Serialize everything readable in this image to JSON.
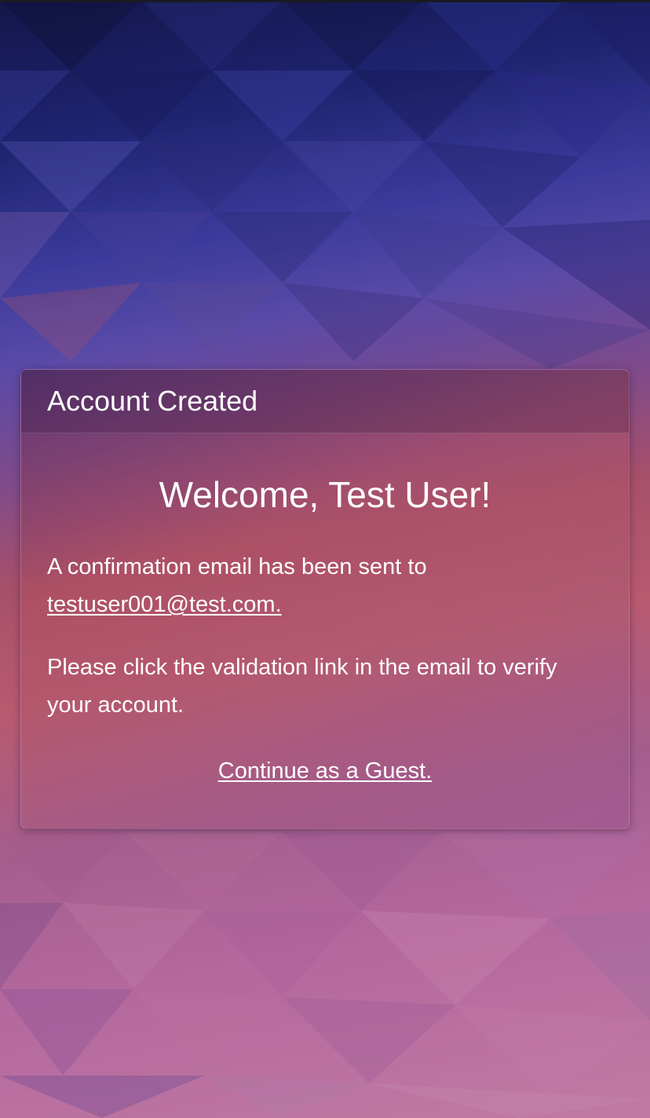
{
  "card": {
    "title": "Account Created",
    "welcome": "Welcome, Test User!",
    "confirmation_prefix": "A confirmation email has been sent to",
    "email": "testuser001@test.com.",
    "instructions": "Please click the validation link in the email to verify your account.",
    "guest_link": "Continue as a Guest."
  },
  "colors": {
    "background_top": "#1e2470",
    "background_mid": "#a8506a",
    "background_bottom": "#c07aa4",
    "text": "#ffffff"
  }
}
